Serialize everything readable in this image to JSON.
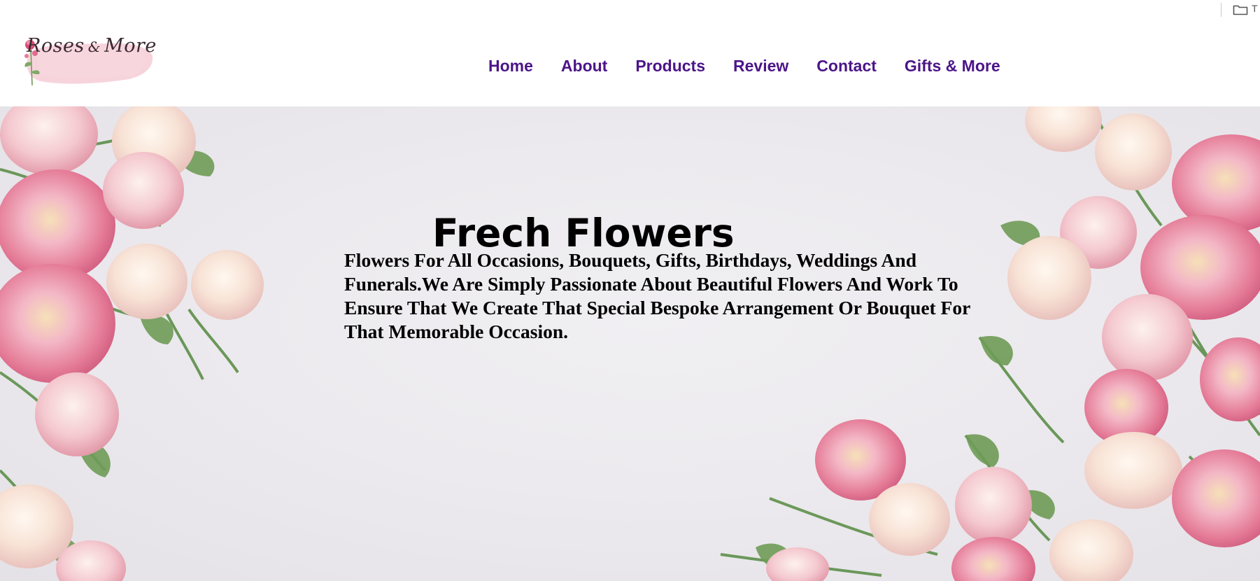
{
  "topbar": {
    "folder_icon": "folder-icon",
    "folder_label": "T"
  },
  "brand": {
    "name_part1": "Roses",
    "ampersand": "&",
    "name_part2": "More"
  },
  "nav": {
    "items": [
      {
        "label": "Home"
      },
      {
        "label": "About"
      },
      {
        "label": "Products"
      },
      {
        "label": "Review"
      },
      {
        "label": "Contact"
      },
      {
        "label": "Gifts & More"
      }
    ],
    "color": "#4b1588"
  },
  "hero": {
    "title": "Frech Flowers",
    "description": "Flowers For All Occasions, Bouquets, Gifts, Birthdays, Weddings And Funerals.We Are Simply Passionate About Beautiful Flowers And Work To Ensure That We Create That Special Bespoke Arrangement Or Bouquet For That Memorable Occasion.",
    "colors": {
      "background": "#eceaee",
      "rose_pink": "#e8879f",
      "rose_cream": "#f5e2d4",
      "stem_green": "#5d8f4a"
    }
  }
}
